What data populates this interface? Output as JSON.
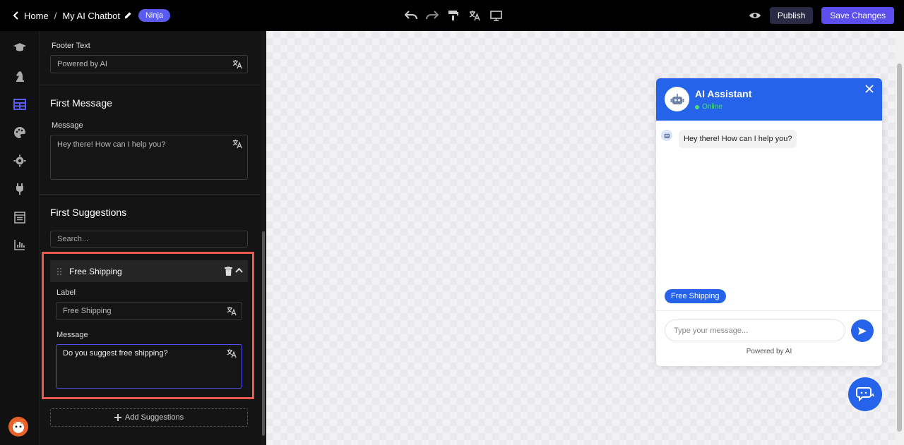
{
  "topbar": {
    "home_label": "Home",
    "separator": "/",
    "chatbot_title": "My AI Chatbot",
    "badge": "Ninja",
    "publish_label": "Publish",
    "save_label": "Save Changes",
    "tools": [
      "undo-icon",
      "redo-icon",
      "paint-format-icon",
      "translate-icon",
      "monitor-icon"
    ]
  },
  "sidebar": {
    "icons": [
      "graduation-cap-icon",
      "chess-knight-icon",
      "layout-grid-icon",
      "palette-icon",
      "gear-icon",
      "plug-icon",
      "calendar-list-icon",
      "bar-chart-icon"
    ],
    "active_index": 2
  },
  "panel": {
    "footer_text_label": "Footer Text",
    "footer_text_value": "Powered by AI",
    "first_message_heading": "First Message",
    "message_label": "Message",
    "message_value": "Hey there! How can I help you?",
    "first_suggestions_heading": "First Suggestions",
    "search_placeholder": "Search...",
    "suggestion": {
      "title": "Free Shipping",
      "label_label": "Label",
      "label_value": "Free Shipping",
      "message_label": "Message",
      "message_value": "Do you suggest free shipping?"
    },
    "add_suggestions_label": "Add Suggestions"
  },
  "preview": {
    "assistant_name": "AI Assistant",
    "status": "Online",
    "greeting": "Hey there! How can I help you?",
    "chip": "Free Shipping",
    "input_placeholder": "Type your message...",
    "powered_by": "Powered by AI"
  },
  "colors": {
    "accent": "#5b4ff0",
    "widget_blue": "#2563eb",
    "highlight": "#e85a4f",
    "online": "#4ade80"
  }
}
